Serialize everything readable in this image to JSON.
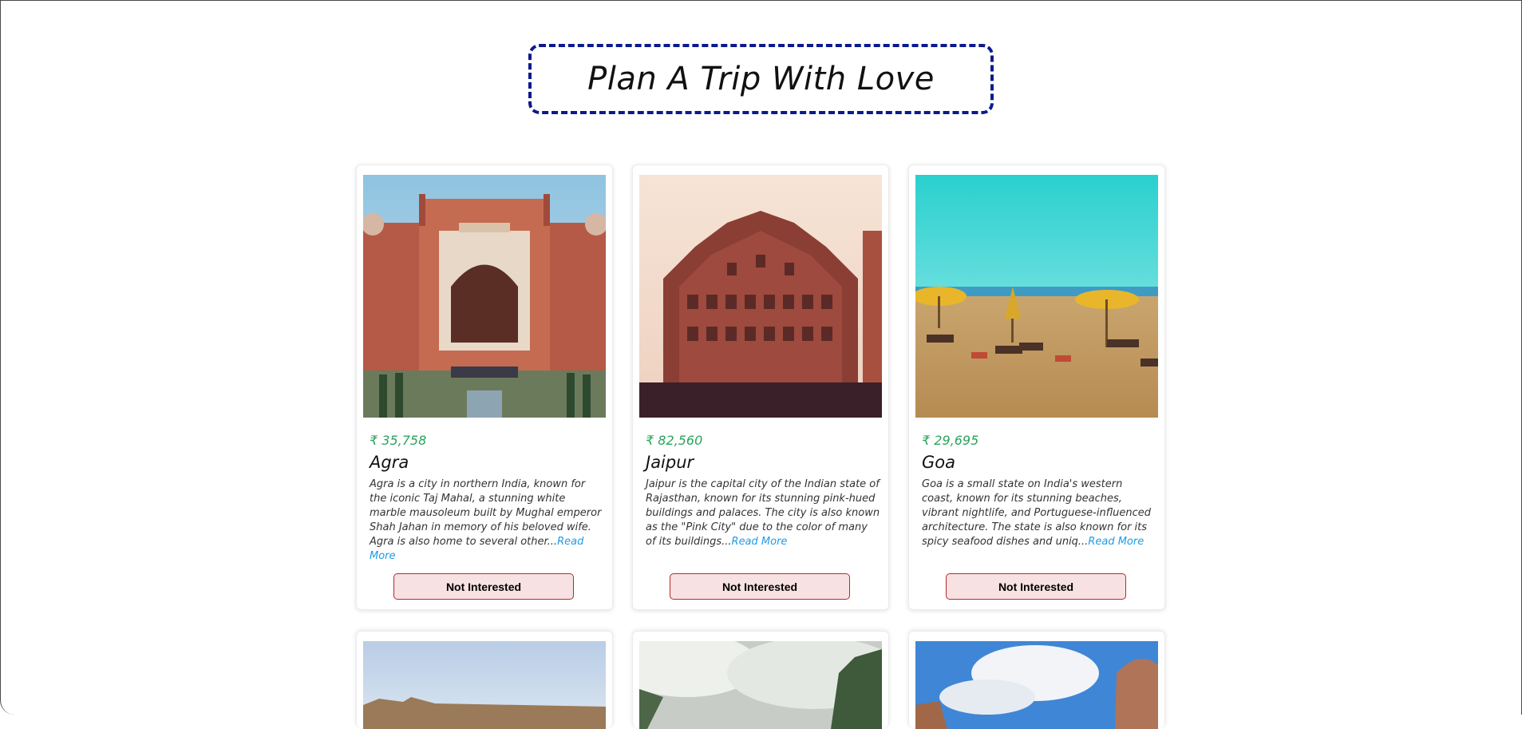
{
  "header": {
    "title": "Plan A Trip With Love"
  },
  "tours": [
    {
      "price": "₹ 35,758",
      "name": "Agra",
      "info": "Agra is a city in northern India, known for the iconic Taj Mahal, a stunning white marble mausoleum built by Mughal emperor Shah Jahan in memory of his beloved wife. Agra is also home to several other...",
      "read_more": "Read More",
      "button": "Not Interested",
      "image": "agra-gate-photo"
    },
    {
      "price": "₹ 82,560",
      "name": "Jaipur",
      "info": "Jaipur is the capital city of the Indian state of Rajasthan, known for its stunning pink-hued buildings and palaces. The city is also known as the \"Pink City\" due to the color of many of its buildings...",
      "read_more": "Read More",
      "button": "Not Interested",
      "image": "hawa-mahal-photo"
    },
    {
      "price": "₹ 29,695",
      "name": "Goa",
      "info": "Goa is a small state on India's western coast, known for its stunning beaches, vibrant nightlife, and Portuguese-influenced architecture. The state is also known for its spicy seafood dishes and uniq...",
      "read_more": "Read More",
      "button": "Not Interested",
      "image": "goa-beach-photo"
    }
  ],
  "colors": {
    "title_border": "#0b1a8c",
    "price": "#2aa35c",
    "read_more": "#1e9be6",
    "button_bg": "#f7e1e2",
    "button_border": "#b52a2a"
  }
}
